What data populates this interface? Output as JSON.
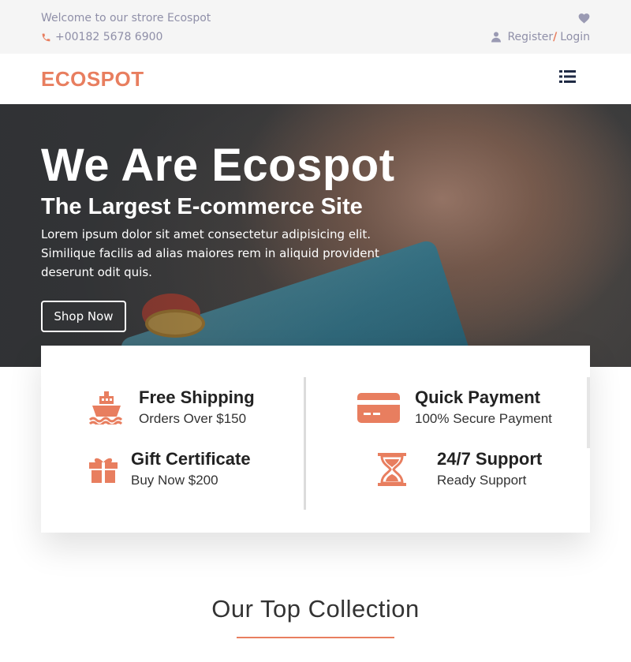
{
  "topbar": {
    "welcome": "Welcome to our strore Ecospot",
    "phone": "+00182 5678 6900",
    "register": "Register",
    "separator": "/",
    "login": "Login"
  },
  "navbar": {
    "brand": "ECOSPOT"
  },
  "hero": {
    "title": "We Are Ecospot",
    "subtitle": "The Largest E-commerce Site",
    "description": "Lorem ipsum dolor sit amet consectetur adipisicing elit. Similique facilis ad alias maiores rem in aliquid provident deserunt odit quis.",
    "button": "Shop Now"
  },
  "features": [
    {
      "icon": "ship-icon",
      "title": "Free Shipping",
      "subtitle": "Orders Over $150"
    },
    {
      "icon": "credit-card-icon",
      "title": "Quick Payment",
      "subtitle": "100% Secure Payment"
    },
    {
      "icon": "gift-icon",
      "title": "Gift Certificate",
      "subtitle": "Buy Now $200"
    },
    {
      "icon": "hourglass-icon",
      "title": "24/7 Support",
      "subtitle": "Ready Support"
    }
  ],
  "section": {
    "title": "Our Top Collection"
  },
  "colors": {
    "accent": "#e87e5f",
    "muted_text": "#8f8fa8",
    "topbar_bg": "#f5f5f5"
  }
}
